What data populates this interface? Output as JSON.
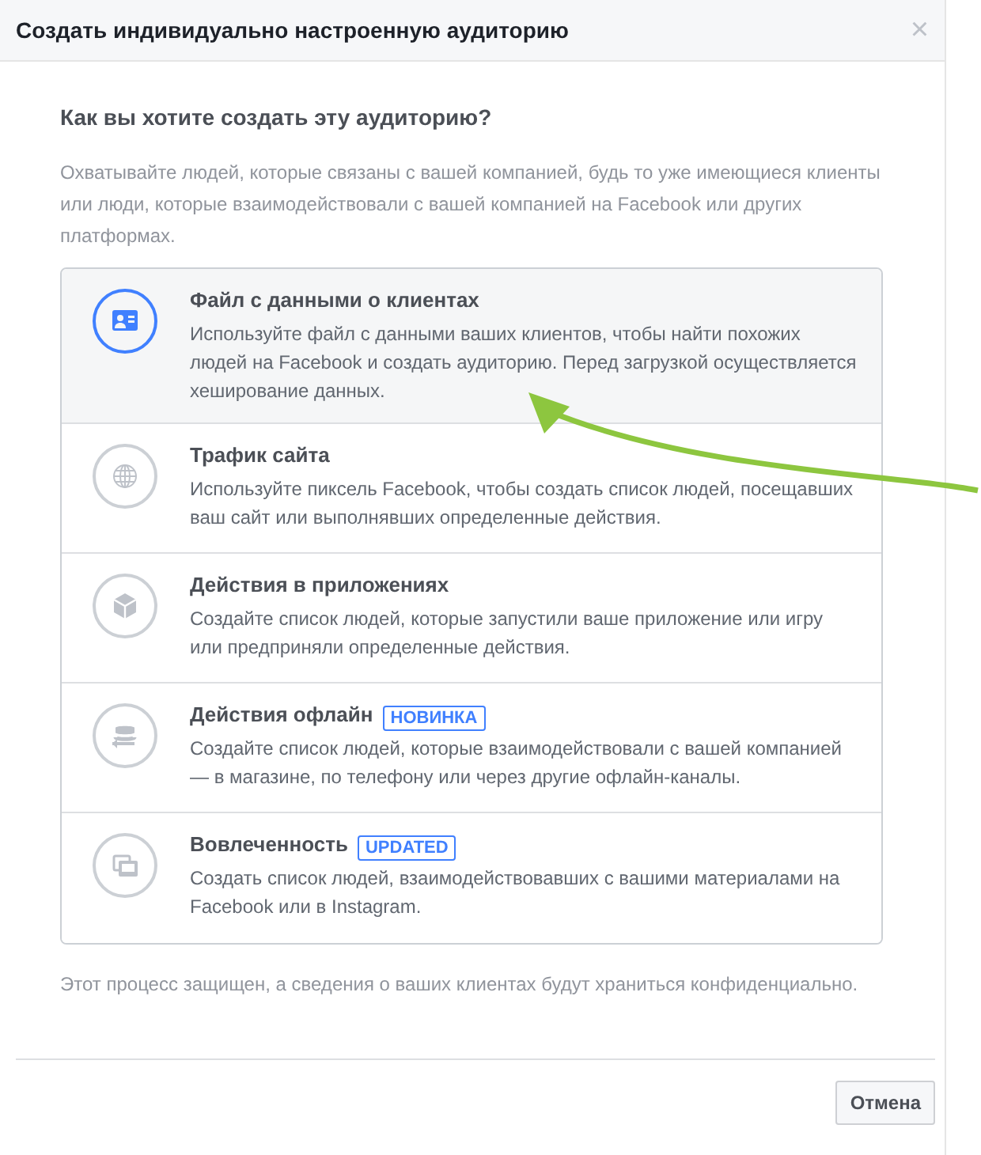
{
  "dialog": {
    "title": "Создать индивидуально настроенную аудиторию",
    "close": "×"
  },
  "question": "Как вы хотите создать эту аудиторию?",
  "intro": "Охватывайте людей, которые связаны с вашей компанией, будь то уже имеющиеся клиенты или люди, которые взаимодействовали с вашей компанией на Facebook или других платформах.",
  "options": [
    {
      "kind": "customer-file",
      "title": "Файл с данными о клиентах",
      "description": "Используйте файл с данными ваших клиентов, чтобы найти похожих людей на Facebook и создать аудиторию. Перед загрузкой осуществляется хеширование данных.",
      "selected": true
    },
    {
      "kind": "website",
      "title": "Трафик сайта",
      "description": "Используйте пиксель Facebook, чтобы создать список людей, посещавших ваш сайт или выполнявших определенные действия.",
      "selected": false
    },
    {
      "kind": "app",
      "title": "Действия в приложениях",
      "description": "Создайте список людей, которые запустили ваше приложение или игру или предприняли определенные действия.",
      "selected": false
    },
    {
      "kind": "offline",
      "title": "Действия офлайн",
      "badge": "НОВИНКА",
      "description": "Создайте список людей, которые взаимодействовали с вашей компанией — в магазине, по телефону или через другие офлайн-каналы.",
      "selected": false
    },
    {
      "kind": "engagement",
      "title": "Вовлеченность",
      "badge": "UPDATED",
      "description": "Создать список людей, взаимодействовавших с вашими материалами на Facebook или в Instagram.",
      "selected": false
    }
  ],
  "privacy_note": "Этот процесс защищен, а сведения о ваших клиентах будут храниться конфиденциально.",
  "buttons": [
    "Отмена"
  ]
}
